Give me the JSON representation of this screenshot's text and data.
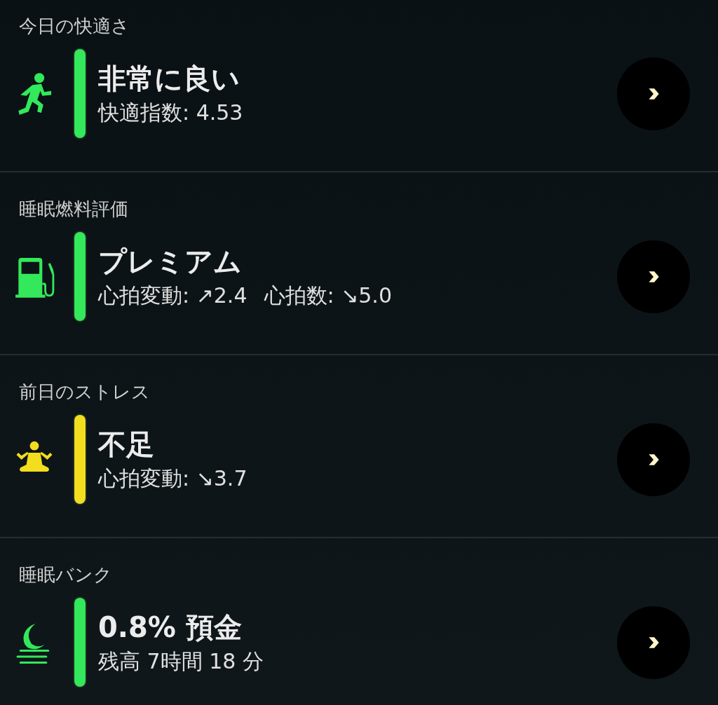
{
  "sections": [
    {
      "title": "今日の快適さ",
      "kind": "run",
      "color": "#33e85a",
      "heading": "非常に良い",
      "details": [
        "快適指数: 4.53"
      ]
    },
    {
      "title": "睡眠燃料評価",
      "kind": "fuel",
      "color": "#33e85a",
      "heading": "プレミアム",
      "details": [
        "心拍変動: ↗2.4",
        "心拍数: ↘5.0"
      ]
    },
    {
      "title": "前日のストレス",
      "kind": "meditate",
      "color": "#f2dd1e",
      "heading": "不足",
      "details": [
        "心拍変動: ↘3.7"
      ]
    },
    {
      "title": "睡眠バンク",
      "kind": "sleep",
      "color": "#33e85a",
      "heading": "0.8% 預金",
      "details": [
        "残高 7時間 18 分"
      ]
    }
  ]
}
